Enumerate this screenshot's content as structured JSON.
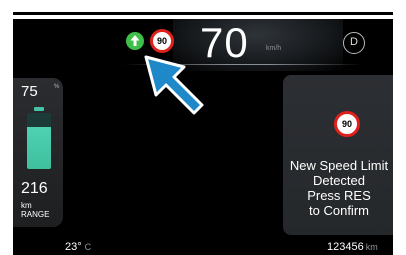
{
  "top_bar": {
    "speed_limit_sign": "90",
    "current_speed": "70",
    "speed_unit": "km/h",
    "gear": "D"
  },
  "battery": {
    "percent": "75",
    "percent_unit": "%",
    "level_fraction": 0.75
  },
  "range": {
    "value": "216",
    "unit": "km",
    "label": "RANGE"
  },
  "notification": {
    "speed_limit_sign": "90",
    "lines": [
      "New Speed Limit",
      "Detected",
      "Press RES",
      "to Confirm"
    ]
  },
  "status_bar": {
    "temperature": "23°",
    "temperature_unit": "C",
    "odometer": "123456",
    "odometer_unit": "km"
  },
  "colors": {
    "battery": "#46c2a5",
    "limit_ring": "#e0201b",
    "arrow_badge": "#3fbf4a",
    "pointer": "#1e88c8"
  },
  "icons": {
    "arrow_badge": "up-arrow-icon",
    "pointer": "pointer-arrow-icon"
  }
}
